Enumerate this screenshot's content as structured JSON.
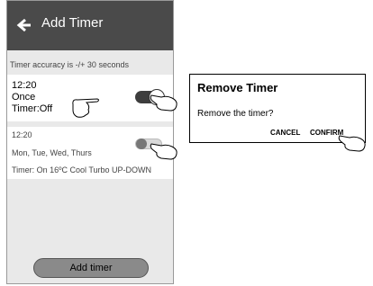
{
  "header": {
    "title": "Add Timer"
  },
  "notice": "Timer accuracy is -/+ 30 seconds",
  "timers": [
    {
      "time": "12:20",
      "repeat": "Once",
      "detail": "Timer:Off",
      "enabled": true
    },
    {
      "time": "12:20",
      "repeat": "Mon, Tue, Wed, Thurs",
      "detail": "Timer: On 16ºC  Cool  Turbo  UP-DOWN",
      "enabled": false
    }
  ],
  "add_button": "Add timer",
  "dialog": {
    "title": "Remove Timer",
    "message": "Remove the timer?",
    "cancel": "CANCEL",
    "confirm": "CONFIRM"
  },
  "colors": {
    "header": "#4a4a4a",
    "page_bg": "#e9e9e9",
    "toggle_on": "#3d3d3d"
  },
  "icons": [
    "back-arrow-icon",
    "pointing-hand-icon"
  ]
}
